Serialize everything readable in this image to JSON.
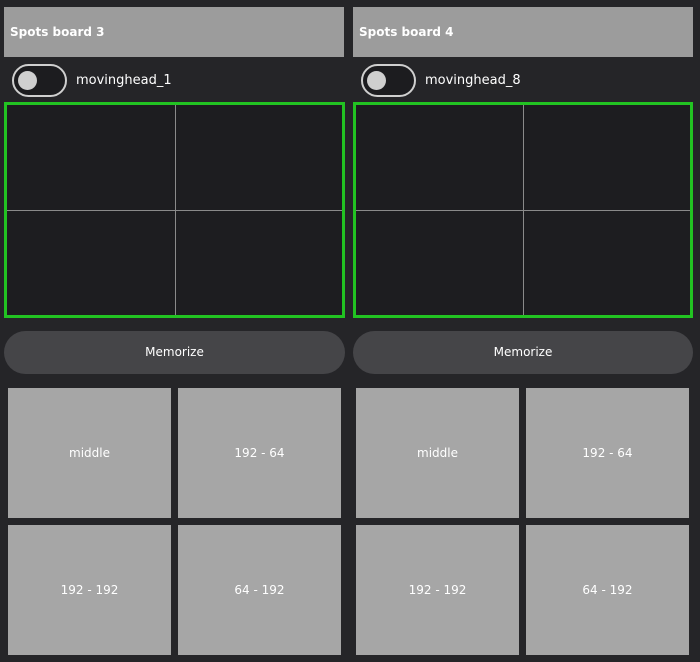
{
  "boards": [
    {
      "title": "Spots board 3",
      "device": "movinghead_1",
      "toggle_on": false,
      "memorize_label": "Memorize",
      "presets": [
        "middle",
        "192 - 64",
        "192 - 192",
        "64 - 192"
      ]
    },
    {
      "title": "Spots board 4",
      "device": "movinghead_8",
      "toggle_on": false,
      "memorize_label": "Memorize",
      "presets": [
        "middle",
        "192 - 64",
        "192 - 192",
        "64 - 192"
      ]
    }
  ],
  "colors": {
    "background": "#252528",
    "header": "#9c9c9c",
    "pad_border": "#22c322",
    "pad_background": "#1d1d20",
    "button": "#454548",
    "preset": "#a6a6a6"
  }
}
